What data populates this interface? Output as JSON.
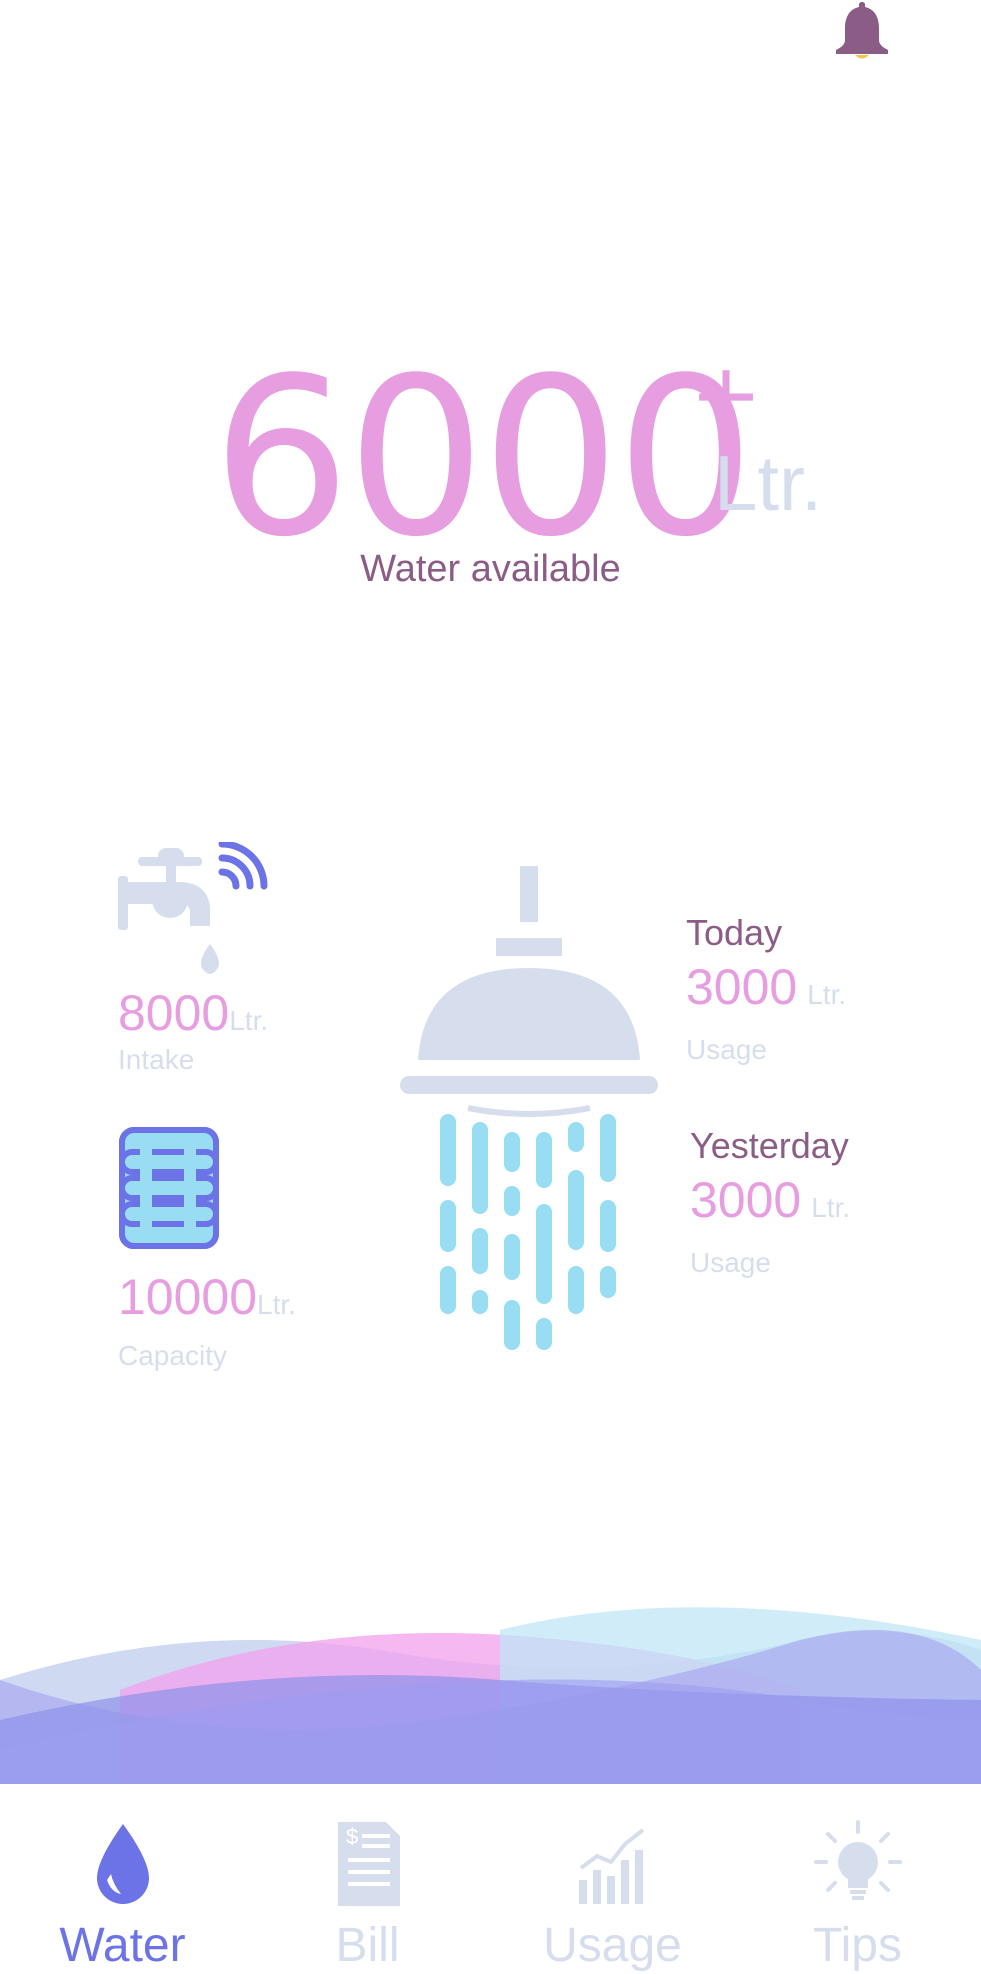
{
  "header": {
    "notification_icon": "bell-icon"
  },
  "hero": {
    "value": "6000",
    "suffix": "+",
    "unit": "Ltr.",
    "label": "Water available"
  },
  "intake": {
    "icon": "smart-faucet-icon",
    "value": "8000",
    "unit": "Ltr.",
    "label": "Intake"
  },
  "capacity": {
    "icon": "water-tank-icon",
    "value": "10000",
    "unit": "Ltr.",
    "label": "Capacity"
  },
  "illustration": {
    "icon": "shower-icon"
  },
  "today": {
    "title": "Today",
    "value": "3000",
    "unit": "Ltr.",
    "label": "Usage"
  },
  "yesterday": {
    "title": "Yesterday",
    "value": "3000",
    "unit": "Ltr.",
    "label": "Usage"
  },
  "tabs": [
    {
      "label": "Water",
      "icon": "water-drop-icon",
      "active": true
    },
    {
      "label": "Bill",
      "icon": "bill-icon",
      "active": false
    },
    {
      "label": "Usage",
      "icon": "usage-chart-icon",
      "active": false
    },
    {
      "label": "Tips",
      "icon": "lightbulb-icon",
      "active": false
    }
  ],
  "colors": {
    "accent_pink": "#e79ee0",
    "muted": "#d6deed",
    "title_purple": "#8b5d86",
    "active_blue": "#6b73e6",
    "water_blue": "#99ddf2"
  }
}
